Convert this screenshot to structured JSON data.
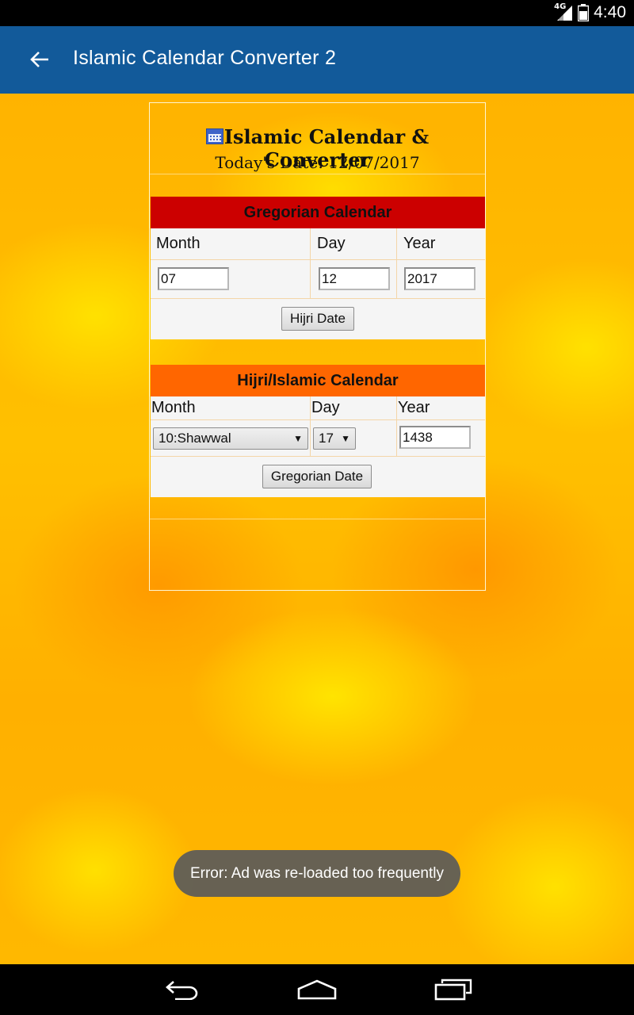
{
  "status_bar": {
    "time": "4:40",
    "network_label": "4G"
  },
  "app_bar": {
    "title": "Islamic Calendar Converter 2",
    "back_icon": "arrow-left-icon"
  },
  "header": {
    "title": "Islamic Calendar & Converter",
    "todays_date": "Today's Date: 12/07/2017",
    "icon": "calendar-icon"
  },
  "gregorian": {
    "heading": "Gregorian Calendar",
    "heading_color": "#cc0000",
    "labels": {
      "month": "Month",
      "day": "Day",
      "year": "Year"
    },
    "values": {
      "month": "07",
      "day": "12",
      "year": "2017"
    },
    "button": "Hijri Date"
  },
  "hijri": {
    "heading": "Hijri/Islamic Calendar",
    "heading_color": "#ff6600",
    "labels": {
      "month": "Month",
      "day": "Day",
      "year": "Year"
    },
    "values": {
      "month": "10:Shawwal",
      "day": "17",
      "year": "1438"
    },
    "button": "Gregorian Date"
  },
  "toast": {
    "message": "Error: Ad was re-loaded too frequently"
  },
  "nav": {
    "back_icon": "nav-back-icon",
    "home_icon": "nav-home-icon",
    "recents_icon": "nav-recents-icon"
  }
}
